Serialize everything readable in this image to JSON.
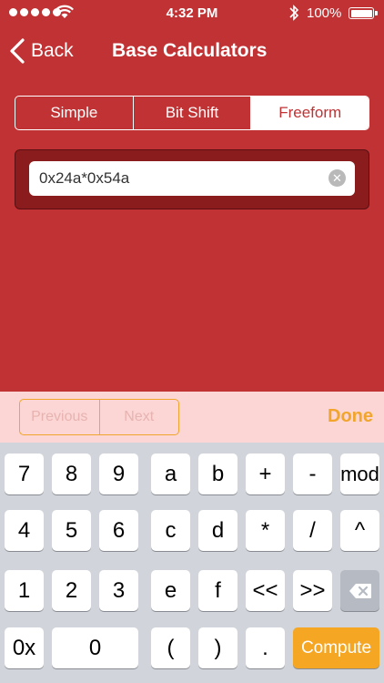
{
  "status": {
    "time": "4:32 PM",
    "battery": "100%",
    "icons": [
      "signal-dots-icon",
      "wifi-icon",
      "bluetooth-icon",
      "battery-icon"
    ]
  },
  "nav": {
    "back_label": "Back",
    "title": "Base Calculators"
  },
  "segments": [
    {
      "label": "Simple",
      "active": false
    },
    {
      "label": "Bit Shift",
      "active": false
    },
    {
      "label": "Freeform",
      "active": true
    }
  ],
  "input": {
    "value": "0x24a*0x54a"
  },
  "toolbar": {
    "previous": "Previous",
    "next": "Next",
    "done": "Done"
  },
  "keys": {
    "row1": [
      "7",
      "8",
      "9",
      "a",
      "b",
      "+",
      "-",
      "mod"
    ],
    "row2": [
      "4",
      "5",
      "6",
      "c",
      "d",
      "*",
      "/",
      "^"
    ],
    "row3": [
      "1",
      "2",
      "3",
      "e",
      "f",
      "<<",
      ">>"
    ],
    "row4": [
      "0x",
      "0",
      "(",
      ")",
      "."
    ],
    "compute": "Compute"
  },
  "colors": {
    "background": "#c03234",
    "accent": "#f5a623"
  }
}
